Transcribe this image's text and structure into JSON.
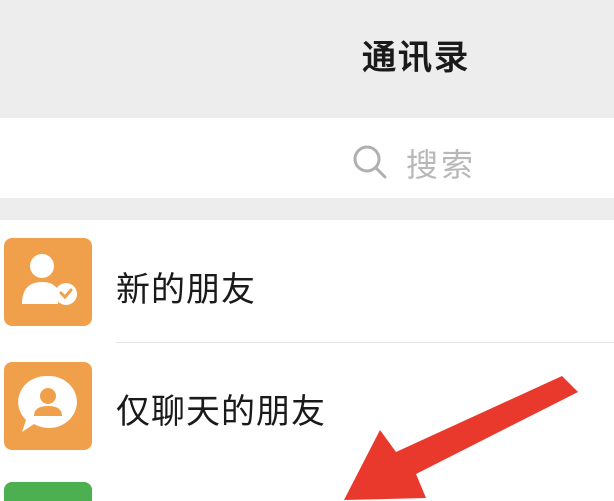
{
  "header": {
    "title": "通讯录"
  },
  "search": {
    "icon": "search-icon",
    "placeholder": "搜索"
  },
  "contacts": {
    "items": [
      {
        "label": "新的朋友",
        "icon": "new-friend-icon",
        "color": "#f0a04b"
      },
      {
        "label": "仅聊天的朋友",
        "icon": "chat-only-friend-icon",
        "color": "#f0a04b"
      },
      {
        "label": "",
        "icon": "group-chat-icon",
        "color": "#4caf50"
      }
    ]
  },
  "annotation": {
    "icon": "red-arrow-icon",
    "color": "#e8392c"
  },
  "colors": {
    "background": "#ededed",
    "list_background": "#ffffff",
    "text": "#1a1a1a",
    "placeholder": "#b8b8b8"
  }
}
